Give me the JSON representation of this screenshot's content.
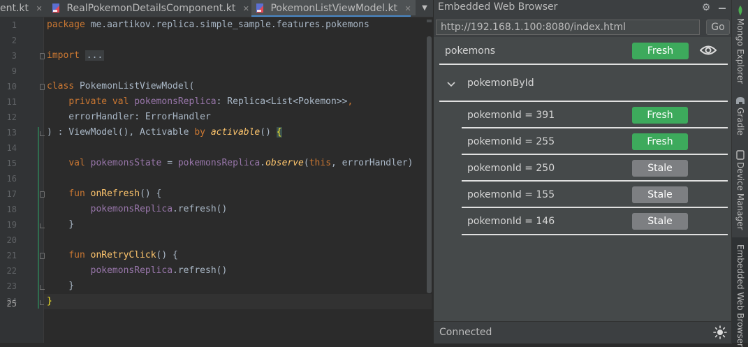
{
  "editor": {
    "tabs": [
      {
        "label": "ent.kt"
      },
      {
        "label": "RealPokemonDetailsComponent.kt"
      },
      {
        "label": "PokemonListViewModel.kt"
      }
    ],
    "close_glyph": "✕",
    "dropdown_glyph": "▼",
    "line_numbers": [
      "1",
      "2",
      "3",
      "9",
      "10",
      "11",
      "12",
      "13",
      "14",
      "15",
      "16",
      "17",
      "18",
      "19",
      "20",
      "21",
      "22",
      "23",
      "24",
      "25"
    ],
    "lines": {
      "l1_kw": "package",
      "l1_rest": " me.aartikov.replica.simple_sample.features.pokemons",
      "l3_kw": "import",
      "l3_fold": "...",
      "l11_kw": "class",
      "l11_rest": " PokemonListViewModel(",
      "l12_indent": "    ",
      "l12_kw": "private val",
      "l12_prop": " pokemonsReplica",
      "l12_rest": ": Replica<List<Pokemon>>",
      "l12_comma": ",",
      "l13": "    errorHandler: ErrorHandler",
      "l14_a": ") : ViewModel(), Activable ",
      "l14_by": "by",
      "l14_space": " ",
      "l14_it": "activable",
      "l14_b": "() ",
      "l14_brace": "{",
      "l16_indent": "    ",
      "l16_kw": "val",
      "l16_prop": " pokemonsState",
      "l16_eq": " = ",
      "l16_prop2": "pokemonsReplica",
      "l16_dot": ".",
      "l16_it": "observe",
      "l16_paren": "(",
      "l16_this": "this",
      "l16_rest": ", errorHandler)",
      "l18_indent": "    ",
      "l18_kw": "fun",
      "l18_fn": " onRefresh",
      "l18_rest": "() {",
      "l19_indent": "        ",
      "l19_prop": "pokemonsReplica",
      "l19_rest": ".refresh()",
      "l20": "    }",
      "l22_indent": "    ",
      "l22_kw": "fun",
      "l22_fn": " onRetryClick",
      "l22_rest": "() {",
      "l23_indent": "        ",
      "l23_prop": "pokemonsReplica",
      "l23_rest": ".refresh()",
      "l24": "    }",
      "l25": "}"
    }
  },
  "panel": {
    "title": "Embedded Web Browser",
    "url": "http://192.168.1.100:8080/index.html",
    "go_label": "Go",
    "gear_glyph": "⚙",
    "status": "Connected",
    "root": {
      "name": "pokemons",
      "state": "Fresh"
    },
    "group": {
      "name": "pokemonById",
      "chevron": "⌄"
    },
    "children": [
      {
        "label": "pokemonId = 391",
        "state": "Fresh"
      },
      {
        "label": "pokemonId = 255",
        "state": "Fresh"
      },
      {
        "label": "pokemonId = 250",
        "state": "Stale"
      },
      {
        "label": "pokemonId = 155",
        "state": "Stale"
      },
      {
        "label": "pokemonId = 146",
        "state": "Stale"
      }
    ],
    "colors": {
      "fresh": "#3daa5c",
      "stale": "#7d7f82",
      "accent": "#4a88c7"
    }
  },
  "strip": {
    "tabs": [
      {
        "label": "Mongo Explorer"
      },
      {
        "label": "Gradle"
      },
      {
        "label": "Device Manager"
      },
      {
        "label": "Embedded Web Browser"
      }
    ]
  }
}
